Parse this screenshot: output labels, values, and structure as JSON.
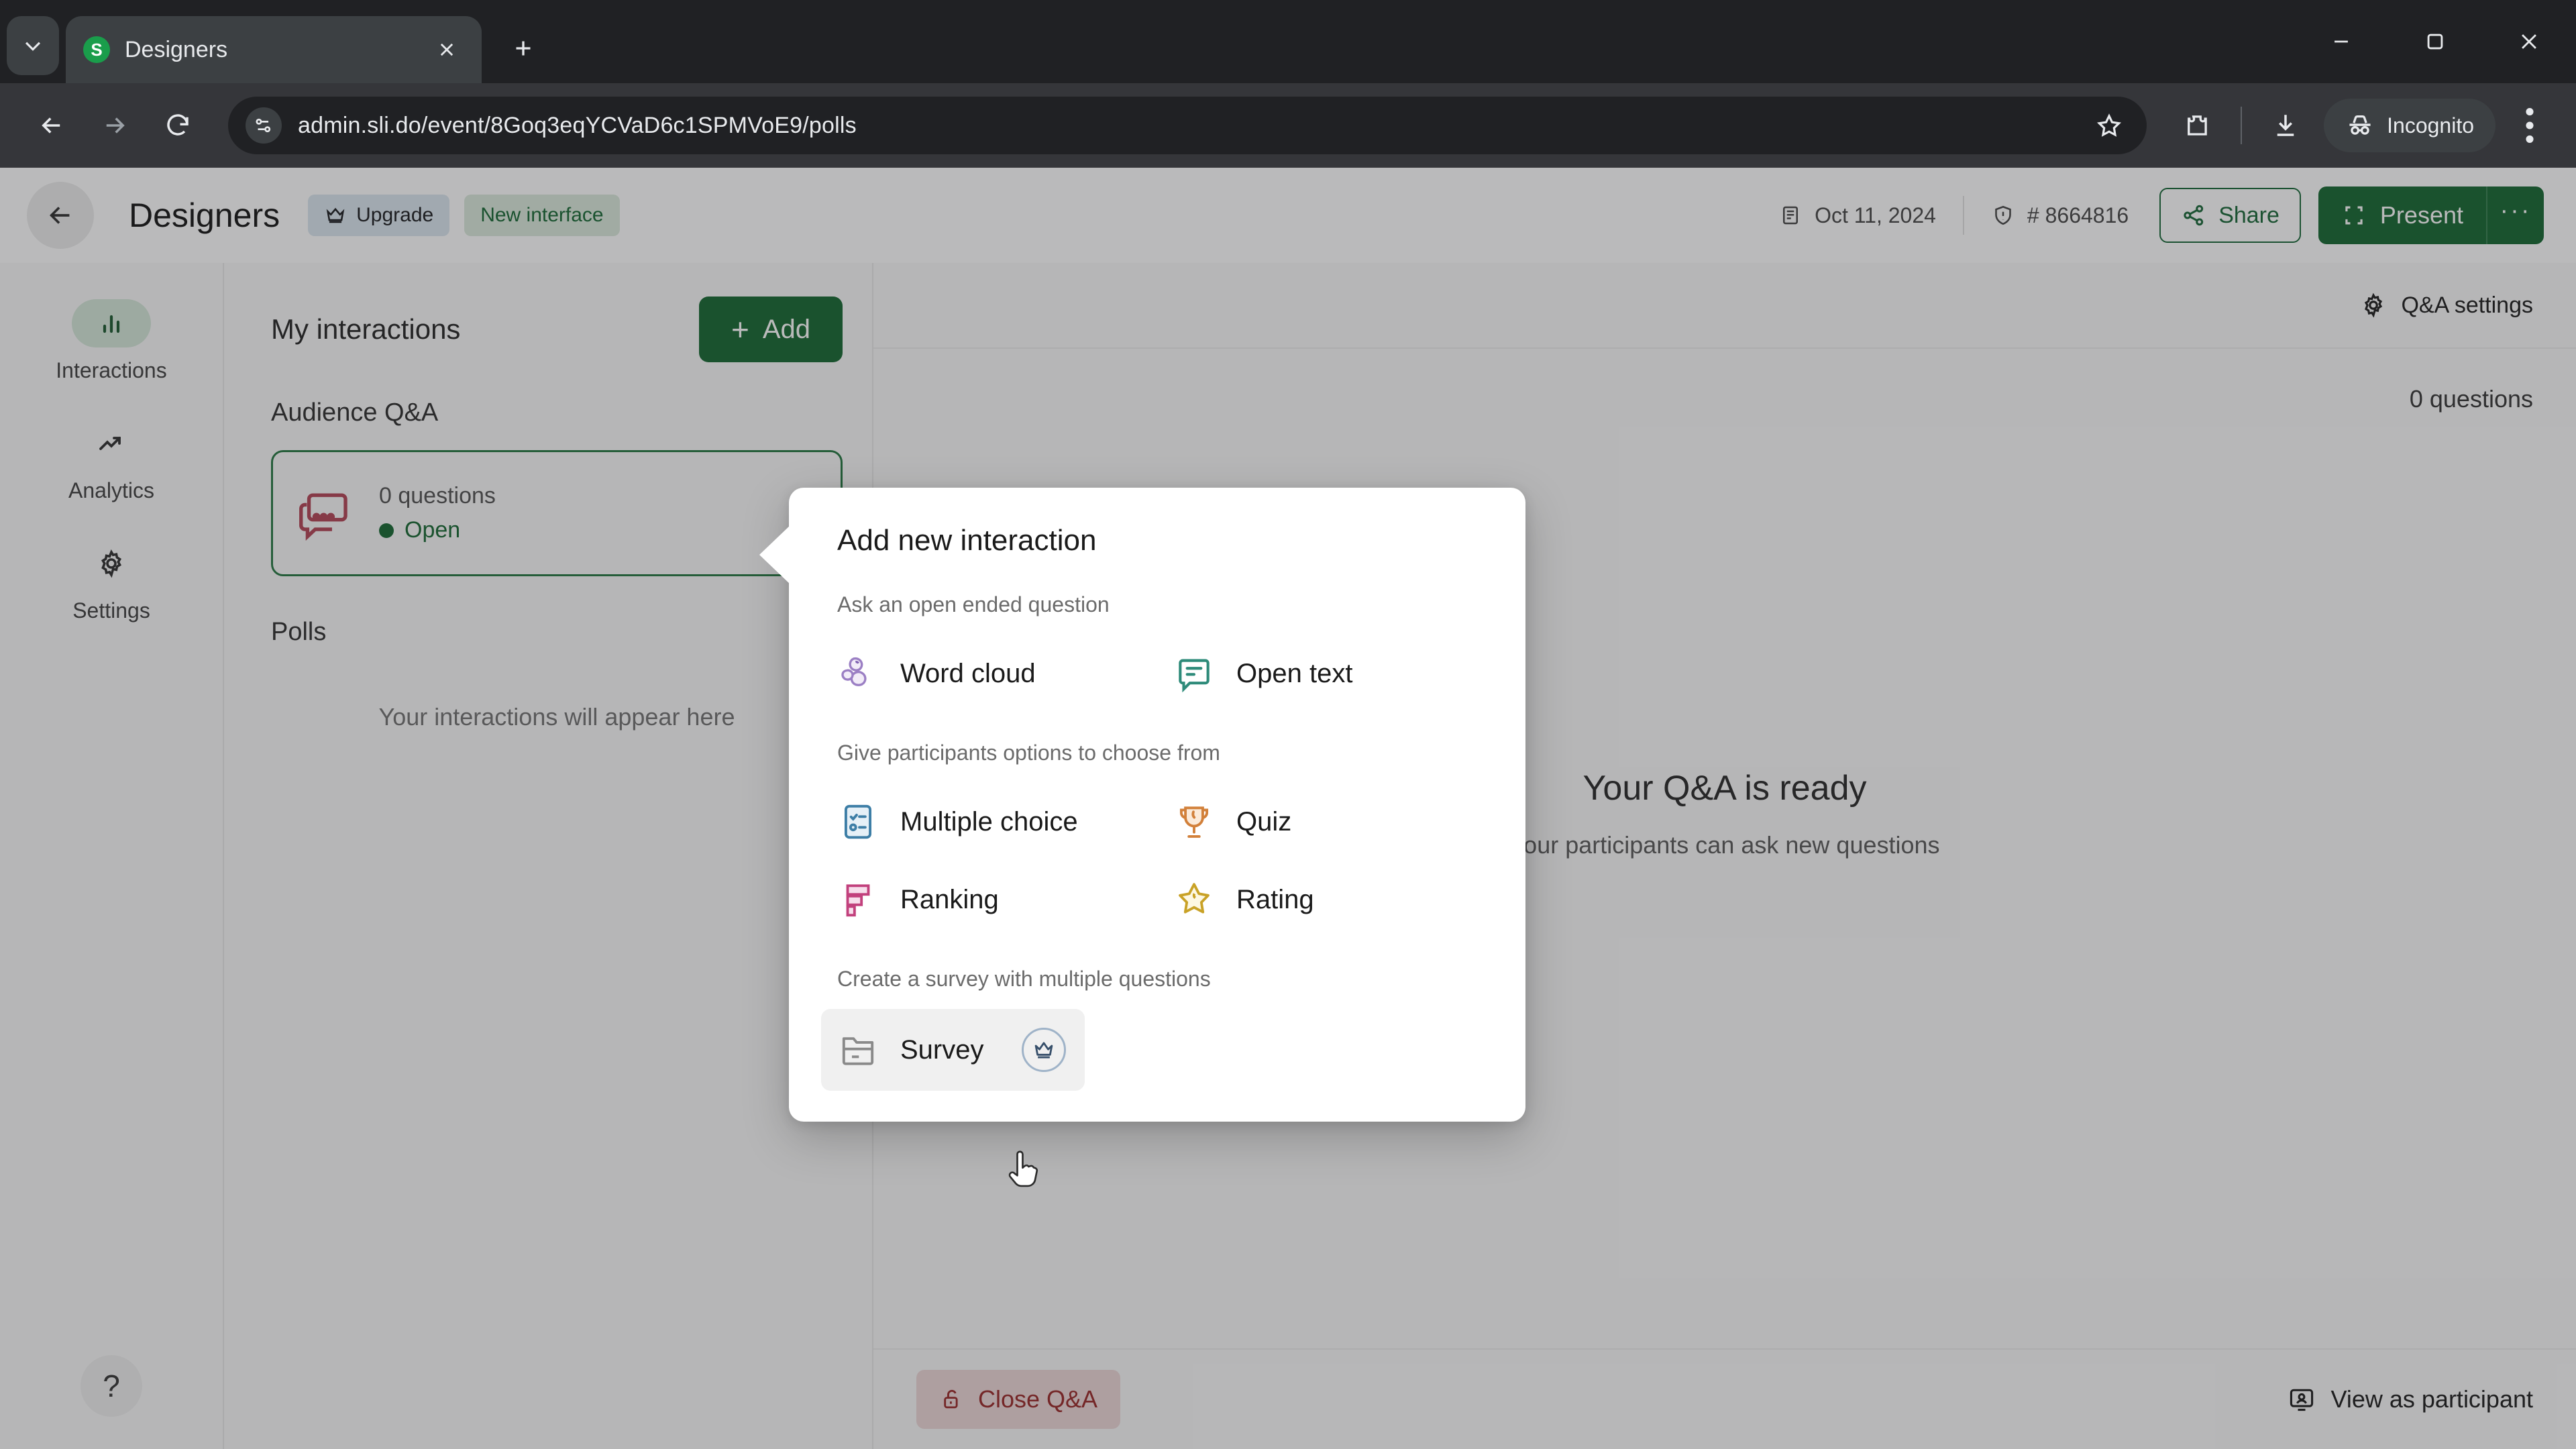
{
  "browser": {
    "tab": {
      "title": "Designers",
      "favicon_letter": "S",
      "favicon_color": "#1a9d4b"
    },
    "new_tab_label": "+",
    "url": "admin.sli.do/event/8Goq3eqYCVaD6c1SPMVoE9/polls",
    "profile_label": "Incognito",
    "icons": {
      "tab_list": "chevron-down-icon",
      "tab_close": "close-icon",
      "back": "back-arrow-icon",
      "forward": "forward-arrow-icon",
      "reload": "reload-icon",
      "site_info": "site-settings-icon",
      "bookmark": "star-icon",
      "extensions": "extensions-puzzle-icon",
      "downloads": "download-icon",
      "incognito": "incognito-hat-icon",
      "menu": "kebab-menu-icon",
      "minimize": "minimize-icon",
      "maximize": "maximize-icon",
      "close_window": "window-close-icon"
    }
  },
  "header": {
    "back_icon": "back-arrow-icon",
    "title": "Designers",
    "upgrade_chip": "Upgrade",
    "new_interface_chip": "New interface",
    "date": "Oct 11, 2024",
    "event_code": "# 8664816",
    "share_label": "Share",
    "present_label": "Present",
    "present_more_label": "···",
    "accent_green": "#1a6b35"
  },
  "sidebar": {
    "items": [
      {
        "label": "Interactions",
        "icon": "bar-chart-icon",
        "active": true
      },
      {
        "label": "Analytics",
        "icon": "trending-up-icon",
        "active": false
      },
      {
        "label": "Settings",
        "icon": "gear-icon",
        "active": false
      }
    ],
    "help_label": "?"
  },
  "left_panel": {
    "title": "My interactions",
    "add_label": "Add",
    "add_plus": "+",
    "sections": [
      {
        "label": "Audience Q&A",
        "card": {
          "count": "0 questions",
          "status": "Open",
          "icon": "qa-speech-bubble-icon"
        }
      },
      {
        "label": "Polls",
        "empty_note": "Your interactions will appear here"
      }
    ]
  },
  "right_panel": {
    "settings_label": "Q&A settings",
    "questions_count": "0 questions",
    "empty_title": "Your Q&A is ready",
    "empty_subtitle": "Your participants can ask new questions",
    "close_label": "Close Q&A",
    "view_label": "View as participant"
  },
  "modal": {
    "title": "Add new interaction",
    "groups": [
      {
        "label": "Ask an open ended question",
        "options": [
          {
            "label": "Word cloud",
            "icon": "word-cloud-icon",
            "color": "#9b7fc4",
            "hovered": false
          },
          {
            "label": "Open text",
            "icon": "open-text-bubble-icon",
            "color": "#2e8b7a",
            "hovered": false
          }
        ]
      },
      {
        "label": "Give participants options to choose from",
        "options": [
          {
            "label": "Multiple choice",
            "icon": "checklist-icon",
            "color": "#3d7ea6",
            "hovered": false
          },
          {
            "label": "Quiz",
            "icon": "trophy-icon",
            "color": "#d2803a",
            "hovered": false
          },
          {
            "label": "Ranking",
            "icon": "ranking-bars-icon",
            "color": "#c2417d",
            "hovered": false
          },
          {
            "label": "Rating",
            "icon": "star-outline-icon",
            "color": "#c9a227",
            "hovered": false
          }
        ]
      },
      {
        "label": "Create a survey with multiple questions",
        "options": [
          {
            "label": "Survey",
            "icon": "folder-icon",
            "color": "#8a8a8a",
            "hovered": true,
            "badge": "crown-badge-icon"
          }
        ]
      }
    ]
  },
  "cursor": {
    "type": "pointing-hand-cursor"
  }
}
